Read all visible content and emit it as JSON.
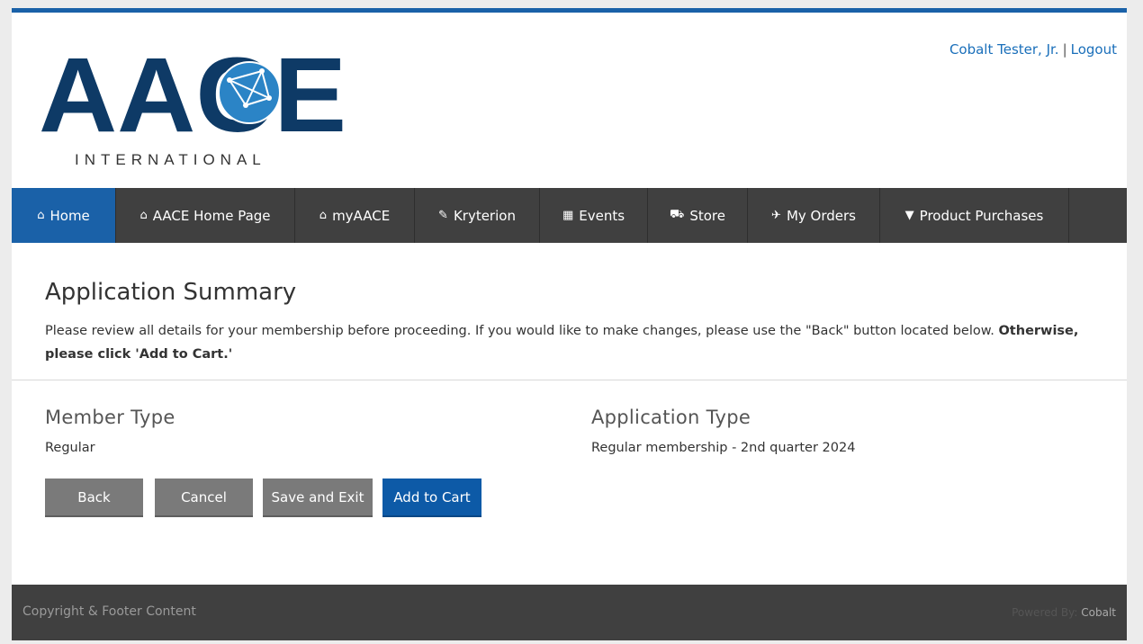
{
  "header": {
    "logo_text": "AACE",
    "logo_subtext": "INTERNATIONAL",
    "user_name": "Cobalt Tester, Jr.",
    "separator": "|",
    "logout_label": "Logout",
    "colors": {
      "brand_navy": "#0e3a66",
      "brand_blue": "#1a61a8"
    }
  },
  "nav": {
    "items": [
      {
        "label": "Home",
        "icon": "home-icon",
        "active": true
      },
      {
        "label": "AACE Home Page",
        "icon": "home-icon"
      },
      {
        "label": "myAACE",
        "icon": "home-icon"
      },
      {
        "label": "Kryterion",
        "icon": "edit-icon"
      },
      {
        "label": "Events",
        "icon": "calendar-icon"
      },
      {
        "label": "Store",
        "icon": "cart-icon"
      },
      {
        "label": "My Orders",
        "icon": "pin-icon"
      },
      {
        "label": "Product Purchases",
        "icon": "glass-icon"
      }
    ]
  },
  "main": {
    "title": "Application Summary",
    "intro_text": "Please review all details for your membership before proceeding. If you would like to make changes, please use the \"Back\" button located below.",
    "intro_bold": "Otherwise, please click 'Add to Cart.'",
    "member_type_heading": "Member Type",
    "member_type_value": "Regular",
    "application_type_heading": "Application Type",
    "application_type_value": "Regular membership - 2nd quarter 2024",
    "buttons": {
      "back": "Back",
      "cancel": "Cancel",
      "save_exit": "Save and Exit",
      "add_to_cart": "Add to Cart"
    }
  },
  "footer": {
    "copyright": "Copyright & Footer Content",
    "powered_by_label": "Powered By:",
    "powered_by_brand": "Cobalt"
  }
}
